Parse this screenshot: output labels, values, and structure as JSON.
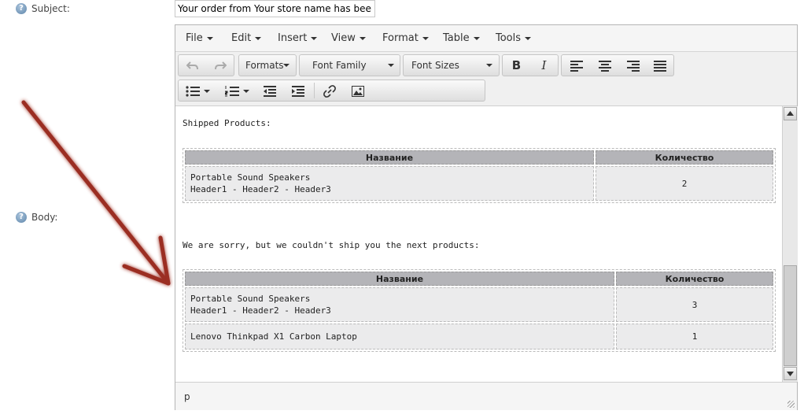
{
  "subject": {
    "label": "Subject:",
    "value": "Your order from Your store name has been"
  },
  "body": {
    "label": "Body:"
  },
  "menubar": [
    "File",
    "Edit",
    "Insert",
    "View",
    "Format",
    "Table",
    "Tools"
  ],
  "toolbar": {
    "formats": "Formats",
    "font_family": "Font Family",
    "font_sizes": "Font Sizes",
    "bold": "B",
    "italic": "I"
  },
  "content": {
    "shipped_heading": "Shipped Products:",
    "shipped_table": {
      "headers": [
        "Название",
        "Количество"
      ],
      "rows": [
        {
          "name": "Portable Sound Speakers",
          "variant": "Header1 - Header2 - Header3",
          "qty": "2"
        }
      ]
    },
    "sorry_text": "We are sorry, but we couldn't ship you the next products:",
    "unshipped_table": {
      "headers": [
        "Название",
        "Количество"
      ],
      "rows": [
        {
          "name": "Portable Sound Speakers",
          "variant": "Header1 - Header2 - Header3",
          "qty": "3"
        },
        {
          "name": "Lenovo Thinkpad X1 Carbon Laptop",
          "variant": "",
          "qty": "1"
        }
      ]
    }
  },
  "statusbar": {
    "path": "p"
  },
  "icons": {
    "help": "question-mark-icon",
    "undo": "undo-icon",
    "redo": "redo-icon",
    "align": [
      "align-left-icon",
      "align-center-icon",
      "align-right-icon",
      "align-justify-icon"
    ],
    "lists": [
      "bullet-list-icon",
      "numbered-list-icon"
    ],
    "indent": [
      "outdent-icon",
      "indent-icon"
    ],
    "link": "link-icon",
    "image": "image-icon"
  },
  "colors": {
    "annotation_arrow": "#9b2d22",
    "table_header": "#b4b4b8",
    "table_cell": "#ebebec"
  }
}
